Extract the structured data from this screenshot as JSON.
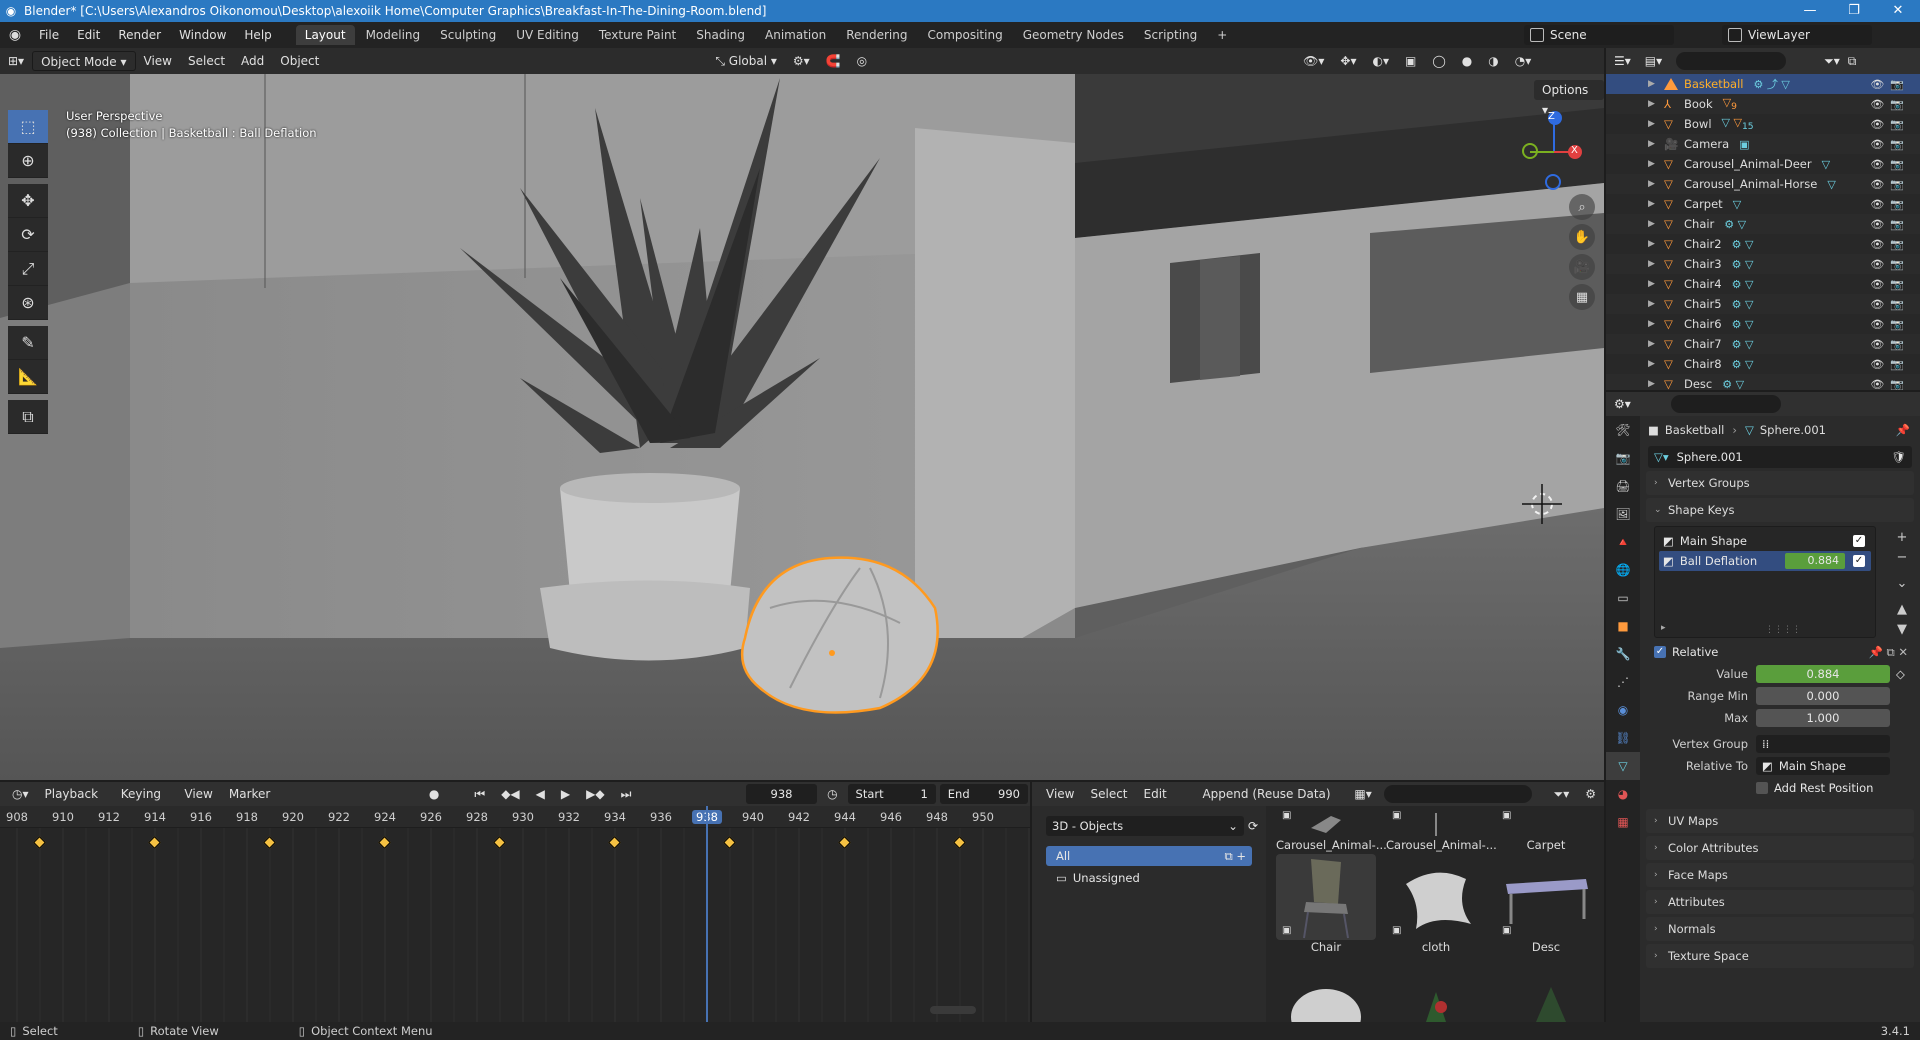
{
  "window": {
    "title": "Blender* [C:\\Users\\Alexandros Oikonomou\\Desktop\\alexoiik Home\\Computer Graphics\\Breakfast-In-The-Dining-Room.blend]",
    "minimize": "—",
    "maximize": "❐",
    "close": "✕"
  },
  "menubar": {
    "menus": [
      "File",
      "Edit",
      "Render",
      "Window",
      "Help"
    ],
    "workspaces": [
      "Layout",
      "Modeling",
      "Sculpting",
      "UV Editing",
      "Texture Paint",
      "Shading",
      "Animation",
      "Rendering",
      "Compositing",
      "Geometry Nodes",
      "Scripting"
    ],
    "add_workspace": "+",
    "scene": "Scene",
    "view_layer": "ViewLayer"
  },
  "viewport": {
    "mode": "Object Mode",
    "menus": [
      "View",
      "Select",
      "Add",
      "Object"
    ],
    "transform_orientation": "Global",
    "options": "Options",
    "info_line1": "User Perspective",
    "info_line2": "(938) Collection | Basketball : Ball Deflation",
    "gizmo": {
      "z": "Z",
      "x": "X"
    }
  },
  "outliner": {
    "rows": [
      {
        "name": "Basketball",
        "selected": true
      },
      {
        "name": "Book",
        "badge": "9"
      },
      {
        "name": "Bowl",
        "badge": "15"
      },
      {
        "name": "Camera"
      },
      {
        "name": "Carousel_Animal-Deer"
      },
      {
        "name": "Carousel_Animal-Horse"
      },
      {
        "name": "Carpet"
      },
      {
        "name": "Chair"
      },
      {
        "name": "Chair2"
      },
      {
        "name": "Chair3"
      },
      {
        "name": "Chair4"
      },
      {
        "name": "Chair5"
      },
      {
        "name": "Chair6"
      },
      {
        "name": "Chair7"
      },
      {
        "name": "Chair8"
      },
      {
        "name": "Desc"
      }
    ]
  },
  "properties": {
    "path_object": "Basketball",
    "path_mesh": "Sphere.001",
    "datablock": "Sphere.001",
    "panels": {
      "vertex_groups": "Vertex Groups",
      "shape_keys": "Shape Keys",
      "uv_maps": "UV Maps",
      "color_attributes": "Color Attributes",
      "face_maps": "Face Maps",
      "attributes": "Attributes",
      "normals": "Normals",
      "texture_space": "Texture Space"
    },
    "shape_keys": [
      {
        "name": "Main Shape",
        "value": ""
      },
      {
        "name": "Ball Deflation",
        "value": "0.884"
      }
    ],
    "relative": "Relative",
    "value_label": "Value",
    "value": "0.884",
    "range_min_label": "Range Min",
    "range_min": "0.000",
    "max_label": "Max",
    "max": "1.000",
    "vertex_group_label": "Vertex Group",
    "relative_to_label": "Relative To",
    "relative_to": "Main Shape",
    "add_rest_position": "Add Rest Position"
  },
  "timeline": {
    "menus": [
      "Playback",
      "Keying",
      "View",
      "Marker"
    ],
    "current_frame": "938",
    "start_label": "Start",
    "start": "1",
    "end_label": "End",
    "end": "990",
    "ticks": [
      "908",
      "910",
      "912",
      "914",
      "916",
      "918",
      "920",
      "922",
      "924",
      "926",
      "928",
      "930",
      "932",
      "934",
      "936",
      "938",
      "940",
      "942",
      "944",
      "946",
      "948",
      "950"
    ],
    "keyframes": [
      909,
      914,
      919,
      924,
      929,
      934,
      939,
      944,
      949
    ]
  },
  "assets": {
    "menus": [
      "View",
      "Select",
      "Edit"
    ],
    "import_mode": "Append (Reuse Data)",
    "library": "3D - Objects",
    "categories": [
      "All",
      "Unassigned"
    ],
    "items_top": [
      "Carousel_Animal-...",
      "Carousel_Animal-...",
      "Carpet"
    ],
    "items_mid": [
      "Chair",
      "cloth",
      "Desc"
    ]
  },
  "statusbar": {
    "select": "Select",
    "rotate": "Rotate View",
    "context": "Object Context Menu",
    "version": "3.4.1"
  },
  "colors": {
    "selection_orange": "#ffaf29",
    "active_blue": "#4772b3",
    "slider_green": "#5a9e3c",
    "titlebar_blue": "#2b79c2"
  }
}
